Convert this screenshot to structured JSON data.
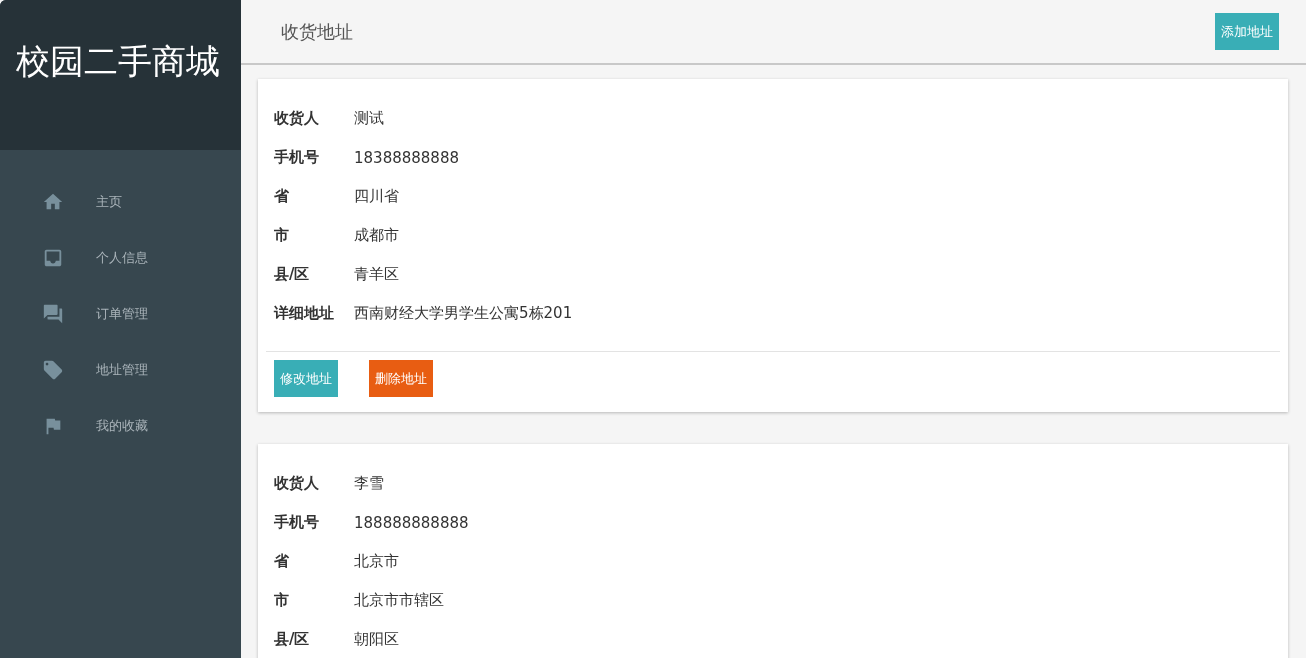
{
  "sidebar": {
    "title": "校园二手商城",
    "items": [
      {
        "label": "主页"
      },
      {
        "label": "个人信息"
      },
      {
        "label": "订单管理"
      },
      {
        "label": "地址管理"
      },
      {
        "label": "我的收藏"
      }
    ]
  },
  "header": {
    "title": "收货地址",
    "add_button": "添加地址"
  },
  "addresses": [
    {
      "fields": [
        {
          "label": "收货人",
          "value": "测试"
        },
        {
          "label": "手机号",
          "value": "18388888888"
        },
        {
          "label": "省",
          "value": "四川省"
        },
        {
          "label": "市",
          "value": "成都市"
        },
        {
          "label": "县/区",
          "value": "青羊区"
        },
        {
          "label": "详细地址",
          "value": "西南财经大学男学生公寓5栋201"
        }
      ],
      "edit_button": "修改地址",
      "delete_button": "删除地址"
    },
    {
      "fields": [
        {
          "label": "收货人",
          "value": "李雪"
        },
        {
          "label": "手机号",
          "value": "188888888888"
        },
        {
          "label": "省",
          "value": "北京市"
        },
        {
          "label": "市",
          "value": "北京市市辖区"
        },
        {
          "label": "县/区",
          "value": "朝阳区"
        }
      ]
    }
  ]
}
